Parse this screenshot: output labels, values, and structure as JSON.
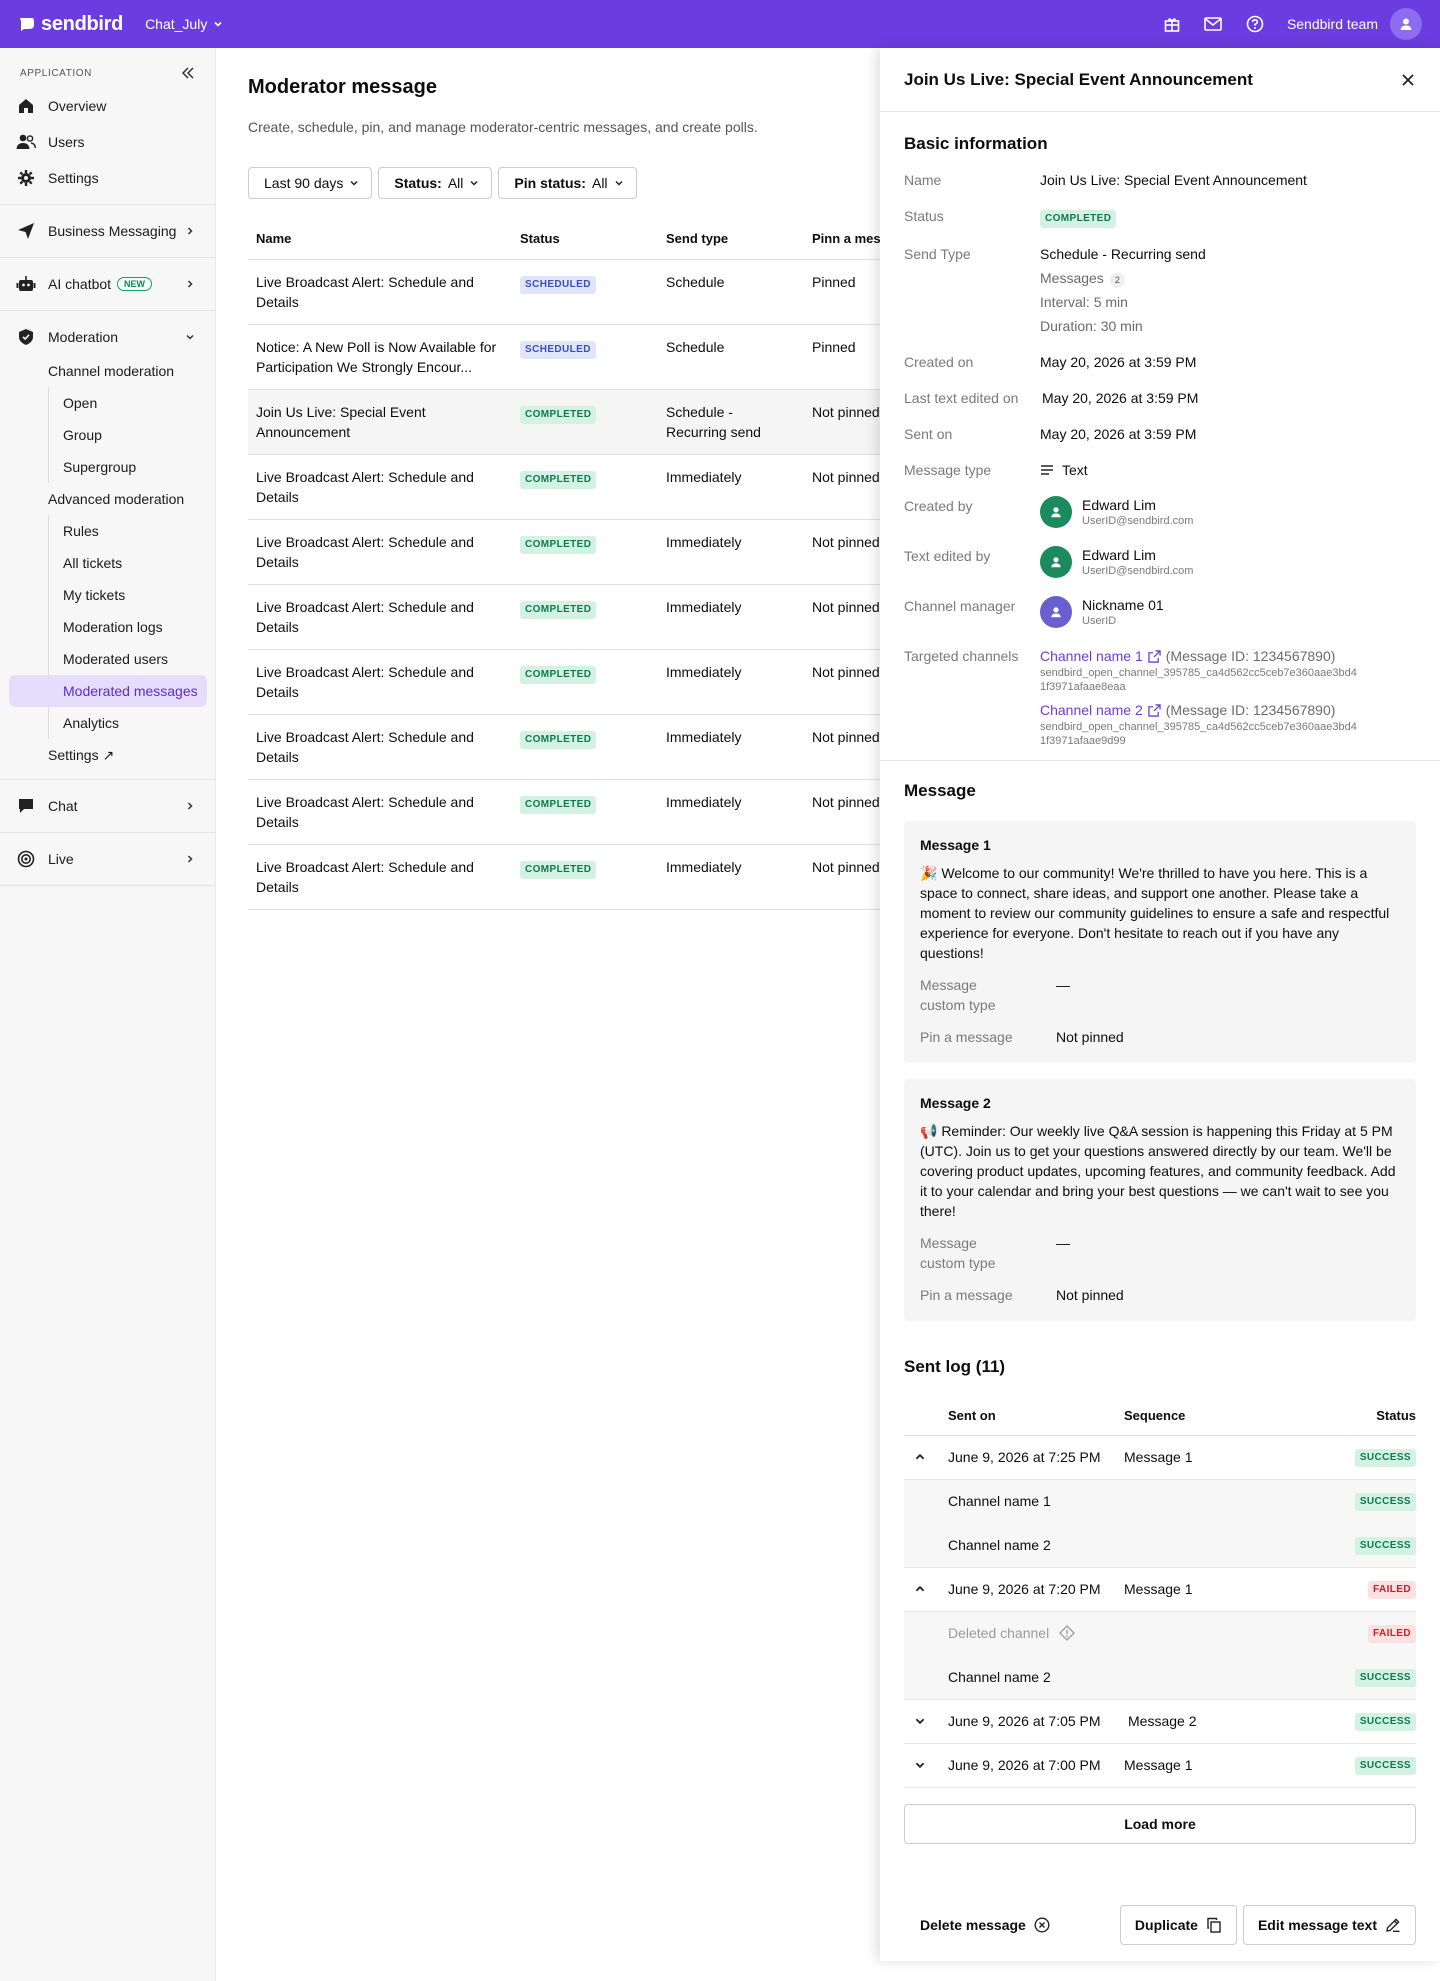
{
  "topbar": {
    "brand": "sendbird",
    "app_name": "Chat_July",
    "team_name": "Sendbird team"
  },
  "sidebar": {
    "section_label": "APPLICATION",
    "overview": "Overview",
    "users": "Users",
    "settings": "Settings",
    "business_messaging": "Business Messaging",
    "ai_chatbot": "AI chatbot",
    "new_badge": "NEW",
    "moderation": "Moderation",
    "channel_moderation": "Channel moderation",
    "open": "Open",
    "group": "Group",
    "supergroup": "Supergroup",
    "advanced_moderation": "Advanced moderation",
    "rules": "Rules",
    "all_tickets": "All tickets",
    "my_tickets": "My tickets",
    "moderation_logs": "Moderation logs",
    "moderated_users": "Moderated users",
    "moderated_messages": "Moderated messages",
    "analytics": "Analytics",
    "mod_settings": "Settings ↗",
    "chat": "Chat",
    "live": "Live"
  },
  "main": {
    "title": "Moderator message",
    "description": "Create, schedule, pin, and manage moderator-centric messages, and create polls.",
    "filter_date": "Last 90 days",
    "filter_status_label": "Status:",
    "filter_status_value": "All",
    "filter_pin_label": "Pin status:",
    "filter_pin_value": "All",
    "columns": [
      "Name",
      "Status",
      "Send type",
      "Pinn a mess"
    ],
    "rows": [
      {
        "name": "Live Broadcast Alert: Schedule and Details",
        "status": "SCHEDULED",
        "send_type": "Schedule",
        "pin": "Pinned"
      },
      {
        "name": "Notice: A New Poll is Now Available for Participation We Strongly Encour...",
        "status": "SCHEDULED",
        "send_type": "Schedule",
        "pin": "Pinned"
      },
      {
        "name": "Join Us Live: Special Event Announcement",
        "status": "COMPLETED",
        "send_type": "Schedule - Recurring send",
        "pin": "Not pinned"
      },
      {
        "name": "Live Broadcast Alert: Schedule and Details",
        "status": "COMPLETED",
        "send_type": "Immediately",
        "pin": "Not pinned"
      },
      {
        "name": "Live Broadcast Alert: Schedule and Details",
        "status": "COMPLETED",
        "send_type": "Immediately",
        "pin": "Not pinned"
      },
      {
        "name": "Live Broadcast Alert: Schedule and Details",
        "status": "COMPLETED",
        "send_type": "Immediately",
        "pin": "Not pinned"
      },
      {
        "name": "Live Broadcast Alert: Schedule and Details",
        "status": "COMPLETED",
        "send_type": "Immediately",
        "pin": "Not pinned"
      },
      {
        "name": "Live Broadcast Alert: Schedule and Details",
        "status": "COMPLETED",
        "send_type": "Immediately",
        "pin": "Not pinned"
      },
      {
        "name": "Live Broadcast Alert: Schedule and Details",
        "status": "COMPLETED",
        "send_type": "Immediately",
        "pin": "Not pinned"
      },
      {
        "name": "Live Broadcast Alert: Schedule and Details",
        "status": "COMPLETED",
        "send_type": "Immediately",
        "pin": "Not pinned"
      }
    ]
  },
  "drawer": {
    "title": "Join Us Live: Special Event Announcement",
    "basic_title": "Basic information",
    "name_label": "Name",
    "name_value": "Join Us Live: Special Event Announcement",
    "status_label": "Status",
    "status_value": "COMPLETED",
    "send_type_label": "Send Type",
    "send_type_value": "Schedule - Recurring send",
    "messages_label": "Messages",
    "messages_count": "2",
    "interval": "Interval: 5 min",
    "duration": "Duration: 30 min",
    "created_on_label": "Created on",
    "created_on_value": "May 20, 2026 at 3:59 PM",
    "last_edit_label": "Last text edited on",
    "last_edit_value": "May 20, 2026 at 3:59 PM",
    "sent_on_label": "Sent on",
    "sent_on_value": "May 20, 2026 at 3:59 PM",
    "msg_type_label": "Message type",
    "msg_type_value": "Text",
    "created_by_label": "Created by",
    "created_by_name": "Edward Lim",
    "created_by_id": "UserID@sendbird.com",
    "edited_by_label": "Text edited by",
    "edited_by_name": "Edward Lim",
    "edited_by_id": "UserID@sendbird.com",
    "manager_label": "Channel manager",
    "manager_name": "Nickname 01",
    "manager_id": "UserID",
    "targeted_label": "Targeted channels",
    "ch1_name": "Channel name 1",
    "ch1_msg": "(Message ID: 1234567890)",
    "ch1_url_a": "sendbird_open_channel_395785_ca4d562cc5ceb7e360aae3bd4",
    "ch1_url_b": "1f3971afaae8eaa",
    "ch2_name": "Channel name 2",
    "ch2_msg": "(Message ID: 1234567890)",
    "ch2_url_a": "sendbird_open_channel_395785_ca4d562cc5ceb7e360aae3bd4",
    "ch2_url_b": "1f3971afaae9d99",
    "message_title": "Message",
    "m1_title": "Message 1",
    "m1_body": "🎉 Welcome to our community! We're thrilled to have you here. This is a space to connect, share ideas, and support one another. Please take a moment to review our community guidelines to ensure a safe and respectful experience for everyone. Don't hesitate to reach out if you have any questions!",
    "m2_title": "Message 2",
    "m2_body": "📢 Reminder: Our weekly live Q&A session is happening this Friday at 5 PM (UTC). Join us to get your questions answered directly by our team. We'll be covering product updates, upcoming features, and community feedback. Add it to your calendar and bring your best questions — we can't wait to see you there!",
    "custom_type_label_1": "Message",
    "custom_type_label_2": "custom type",
    "custom_type_value": "—",
    "pin_label": "Pin a message",
    "pin_value": "Not pinned",
    "log_title": "Sent log (11)",
    "log_cols": [
      "Sent on",
      "Sequence",
      "Status"
    ],
    "log_rows": [
      {
        "date": "June 9, 2026 at 7:25 PM",
        "seq": "Message 1",
        "status": "SUCCESS"
      },
      {
        "channel": "Channel name 1",
        "status": "SUCCESS"
      },
      {
        "channel": "Channel name 2",
        "status": "SUCCESS"
      },
      {
        "date": "June 9, 2026 at 7:20 PM",
        "seq": "Message 1",
        "status": "FAILED"
      },
      {
        "channel": "Deleted channel",
        "status": "FAILED"
      },
      {
        "channel": "Channel name 2",
        "status": "SUCCESS"
      },
      {
        "date": "June 9, 2026 at 7:05 PM",
        "seq": "Message 2",
        "status": "SUCCESS"
      },
      {
        "date": "June 9, 2026 at 7:00 PM",
        "seq": "Message 1",
        "status": "SUCCESS"
      }
    ],
    "load_more": "Load more",
    "delete": "Delete message",
    "duplicate": "Duplicate",
    "edit": "Edit message text"
  },
  "colors": {
    "brand_purple": "#6b3de0",
    "success_bg": "#d4f2e4",
    "failed_bg": "#fde0e0",
    "scheduled_bg": "#dfe6fc"
  },
  "icons": [
    "gift-icon",
    "mail-icon",
    "help-icon",
    "user-icon",
    "collapse-icon",
    "home-icon",
    "users-icon",
    "gear-icon",
    "send-icon",
    "bot-icon",
    "shield-icon",
    "chat-icon",
    "live-icon",
    "chevron-icon",
    "close-icon",
    "external-link-icon",
    "text-icon",
    "copy-icon",
    "pencil-icon",
    "x-circle-icon",
    "diamond-info-icon"
  ]
}
